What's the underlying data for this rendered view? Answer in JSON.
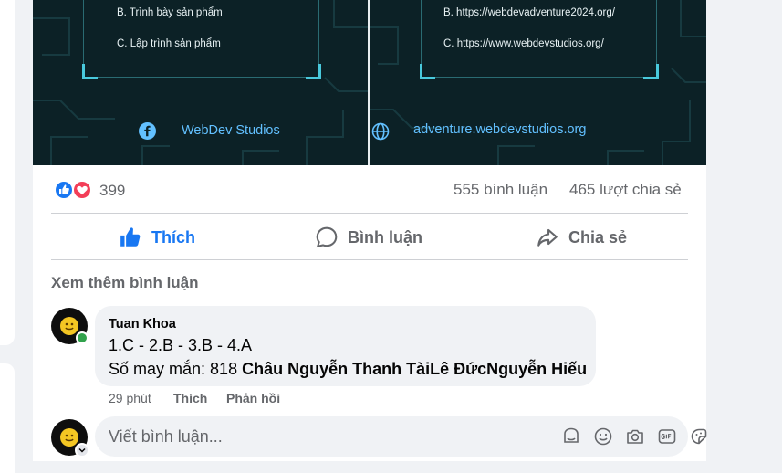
{
  "post": {
    "left_panel": {
      "options": [
        "B. Trình bày sản phẩm",
        "C. Lập trình sản phẩm"
      ],
      "brand": "WebDev Studios",
      "brand_icon": "facebook-icon"
    },
    "right_panel": {
      "options": [
        "B. https://webdevadventure2024.org/",
        "C. https://www.webdevstudios.org/"
      ],
      "brand": "adventure.webdevstudios.org",
      "brand_icon": "globe-icon"
    },
    "reactions_count": "399",
    "comments_count": "555 bình luận",
    "shares_count": "465 lượt chia sẻ",
    "actions": {
      "like": "Thích",
      "comment": "Bình luận",
      "share": "Chia sẻ"
    },
    "view_more": "Xem thêm bình luận"
  },
  "comment": {
    "author": "Tuan Khoa",
    "line1": "1.C - 2.B - 3.B - 4.A",
    "line2_prefix": "Số may mắn: 818 ",
    "mentions": [
      "Châu Nguyễn Thanh Tài",
      "Lê Đức",
      "Nguyễn Hiếu"
    ],
    "time": "29 phút",
    "like": "Thích",
    "reply": "Phản hồi"
  },
  "composer": {
    "placeholder": "Viết bình luận..."
  },
  "colors": {
    "accent": "#1877f2",
    "love": "#f33e58",
    "online": "#31a24c",
    "brand_text": "#62c0ff"
  }
}
